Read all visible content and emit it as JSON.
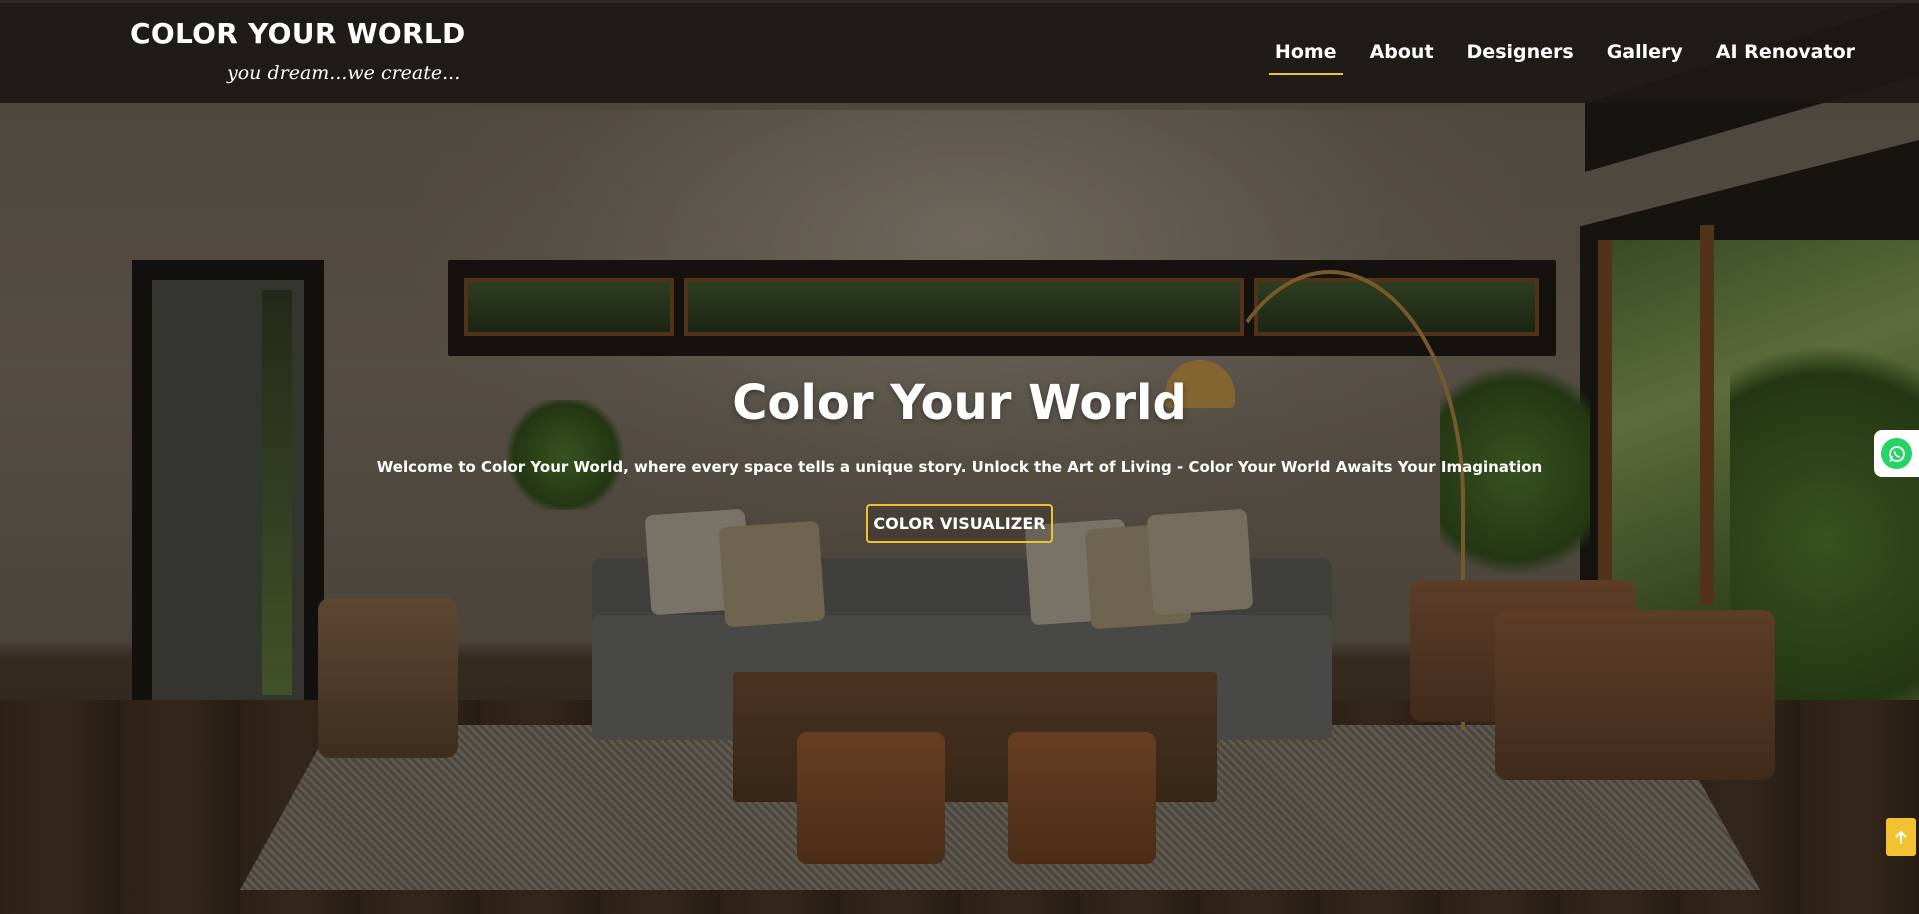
{
  "brand": {
    "title": "COLOR YOUR WORLD",
    "tagline": "you dream...we create..."
  },
  "nav": {
    "items": [
      {
        "label": "Home",
        "active": true
      },
      {
        "label": "About",
        "active": false
      },
      {
        "label": "Designers",
        "active": false
      },
      {
        "label": "Gallery",
        "active": false
      },
      {
        "label": "AI Renovator",
        "active": false
      }
    ]
  },
  "hero": {
    "title": "Color Your World",
    "subtitle": "Welcome to Color Your World, where every space tells a unique story. Unlock the Art of Living - Color Your World Awaits Your Imagination",
    "cta_label": "COLOR VISUALIZER",
    "background_icon": "living-room-photo"
  },
  "floating": {
    "whatsapp_icon": "whatsapp-icon",
    "scroll_top_icon": "arrow-up-icon"
  },
  "colors": {
    "accent": "#f2c230",
    "header_bg": "#1c1813",
    "text": "#ffffff",
    "whatsapp": "#25d366"
  }
}
